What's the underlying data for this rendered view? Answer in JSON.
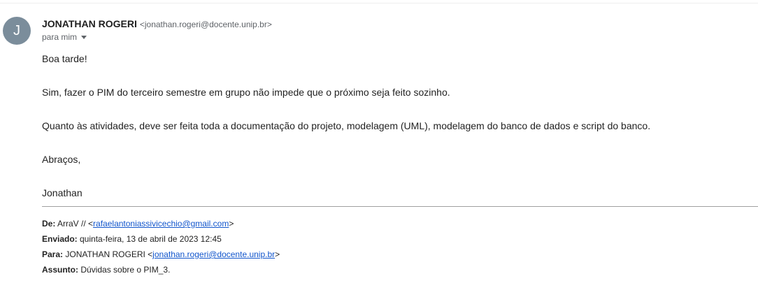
{
  "header": {
    "avatar_letter": "J",
    "sender_name": "JONATHAN ROGERI",
    "sender_email": "<jonathan.rogeri@docente.unip.br>",
    "recipient_label": "para mim"
  },
  "body": {
    "greeting": "Boa tarde!",
    "paragraph_1": "Sim, fazer o PIM do terceiro semestre em grupo não impede que o próximo seja feito sozinho.",
    "paragraph_2": "Quanto às atividades, deve ser feita toda a documentação do projeto, modelagem (UML), modelagem do banco de dados e script do banco.",
    "closing": "Abraços,",
    "signature": "Jonathan"
  },
  "quoted": {
    "from_label": "De:",
    "from_name": " ArraV // <",
    "from_email": "rafaelantoniassivicechio@gmail.com",
    "from_suffix": ">",
    "sent_label": "Enviado:",
    "sent_value": " quinta-feira, 13 de abril de 2023 12:45",
    "to_label": "Para:",
    "to_name": " JONATHAN ROGERI <",
    "to_email": "jonathan.rogeri@docente.unip.br",
    "to_suffix": ">",
    "subject_label": "Assunto:",
    "subject_value": " Dúvidas sobre o PIM_3."
  }
}
